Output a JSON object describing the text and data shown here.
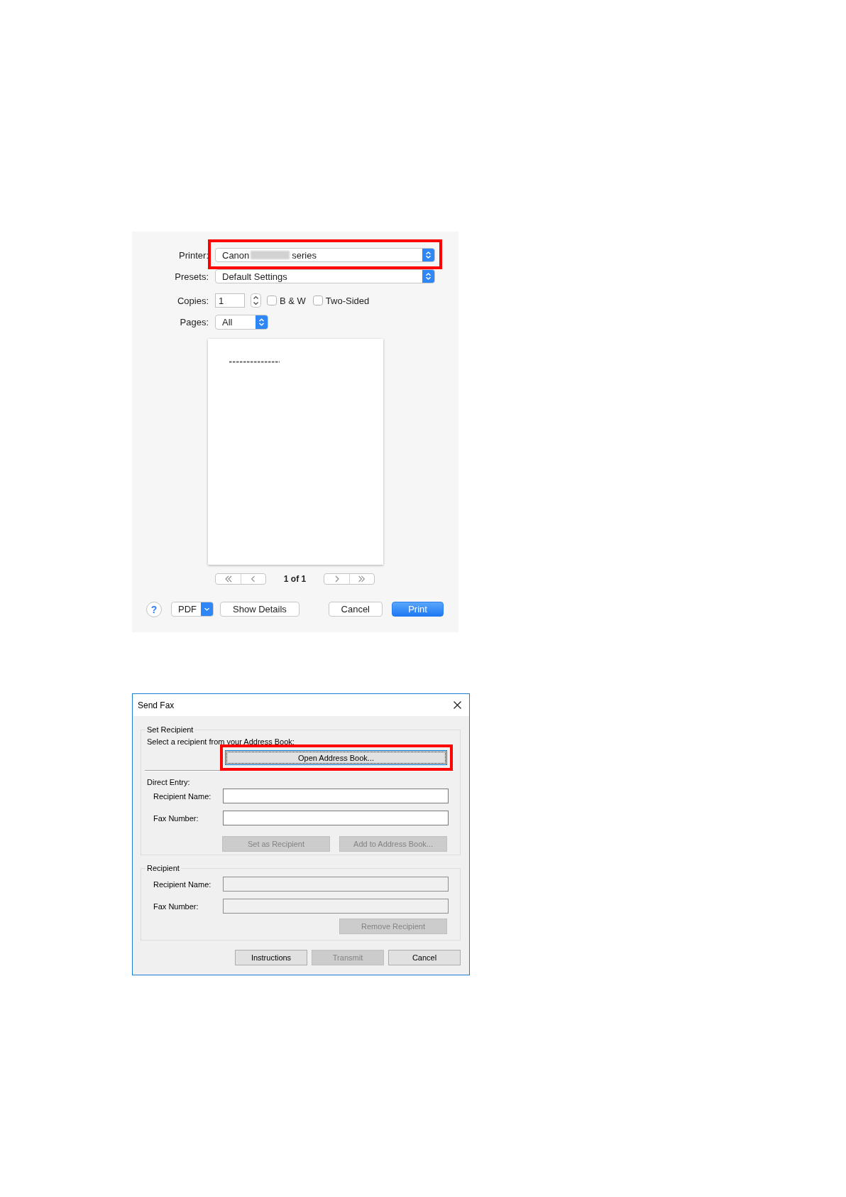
{
  "print_dialog": {
    "printer": {
      "label": "Printer:",
      "value_before": "Canon",
      "redacted": true,
      "value_after": "series",
      "highlighted": true
    },
    "presets": {
      "label": "Presets:",
      "value": "Default Settings"
    },
    "copies": {
      "label": "Copies:",
      "value": "1"
    },
    "options": [
      {
        "label": "B & W",
        "checked": false
      },
      {
        "label": "Two-Sided",
        "checked": false
      }
    ],
    "pages": {
      "label": "Pages:",
      "value": "All"
    },
    "preview": {
      "page_indicator": "1 of 1"
    },
    "footer": {
      "left": [
        {
          "kind": "help",
          "label": "?"
        },
        {
          "kind": "menu",
          "label": "PDF"
        },
        {
          "kind": "push",
          "label": "Show Details",
          "default": false
        }
      ],
      "right": [
        {
          "kind": "push",
          "label": "Cancel",
          "default": false
        },
        {
          "kind": "push",
          "label": "Print",
          "default": true
        }
      ]
    }
  },
  "fax_dialog": {
    "title": "Send Fax",
    "set_recipient": {
      "title": "Set Recipient",
      "instruction": "Select a recipient from your Address Book:",
      "address_book_button": {
        "label": "Open Address Book...",
        "disabled": false,
        "focused": true,
        "highlighted": true
      },
      "direct_entry": {
        "title": "Direct Entry:",
        "fields": [
          {
            "label": "Recipient Name:",
            "disabled": false
          },
          {
            "label": "Fax Number:",
            "disabled": false
          }
        ],
        "buttons": [
          {
            "label": "Set as Recipient",
            "disabled": true
          },
          {
            "label": "Add to Address Book...",
            "disabled": true
          }
        ]
      }
    },
    "recipient": {
      "title": "Recipient",
      "fields": [
        {
          "label": "Recipient Name:",
          "disabled": true
        },
        {
          "label": "Fax Number:",
          "disabled": true
        }
      ],
      "buttons": [
        {
          "label": "Remove Recipient",
          "disabled": true
        }
      ]
    },
    "buttons": [
      {
        "label": "Instructions",
        "disabled": false
      },
      {
        "label": "Transmit",
        "disabled": true
      },
      {
        "label": "Cancel",
        "disabled": false
      }
    ]
  }
}
